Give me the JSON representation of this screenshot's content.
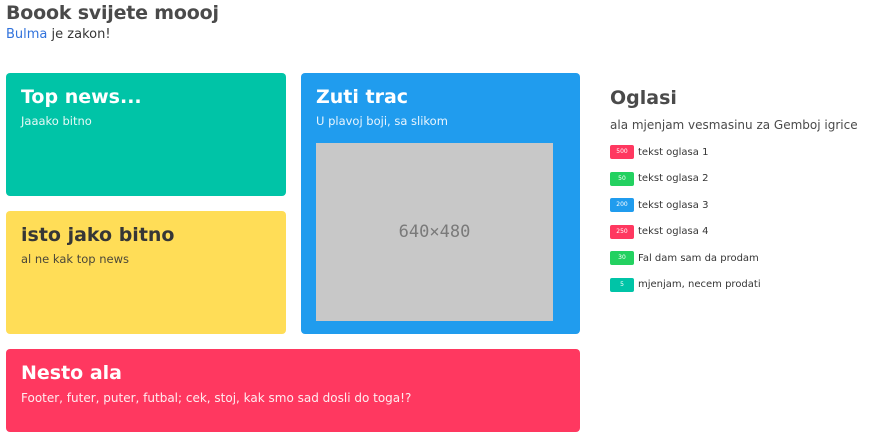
{
  "header": {
    "title": "Boook svijete moooj",
    "subtitle_link": "Bulma",
    "subtitle_rest": " je zakon!"
  },
  "tiles": {
    "top_news": {
      "title": "Top news...",
      "subtitle": "Jaaako bitno"
    },
    "isto": {
      "title": "isto jako bitno",
      "subtitle": "al ne kak top news"
    },
    "zuti": {
      "title": "Zuti trac",
      "subtitle": "U plavoj boji, sa slikom",
      "image_label": "640×480"
    },
    "nesto": {
      "title": "Nesto ala",
      "subtitle": "Footer, futer, puter, futbal; cek, stoj, kak smo sad dosli do toga!?"
    }
  },
  "ads": {
    "title": "Oglasi",
    "subtitle": "ala mjenjam vesmasinu za Gemboj igrice",
    "items": [
      {
        "tag": "500",
        "tag_color": "#ff3860",
        "text": "tekst oglasa 1"
      },
      {
        "tag": "50",
        "tag_color": "#23d160",
        "text": "tekst oglasa 2"
      },
      {
        "tag": "200",
        "tag_color": "#209cee",
        "text": "tekst oglasa 3"
      },
      {
        "tag": "250",
        "tag_color": "#ff3860",
        "text": "tekst oglasa 4"
      },
      {
        "tag": "30",
        "tag_color": "#23d160",
        "text": "Fal dam sam da prodam"
      },
      {
        "tag": "5",
        "tag_color": "#00c4a7",
        "text": "mjenjam, necem prodati"
      }
    ]
  },
  "colors": {
    "turquoise": "#00c4a7",
    "warning": "#ffdd57",
    "info": "#209cee",
    "danger": "#ff3860",
    "link": "#3273dc"
  }
}
